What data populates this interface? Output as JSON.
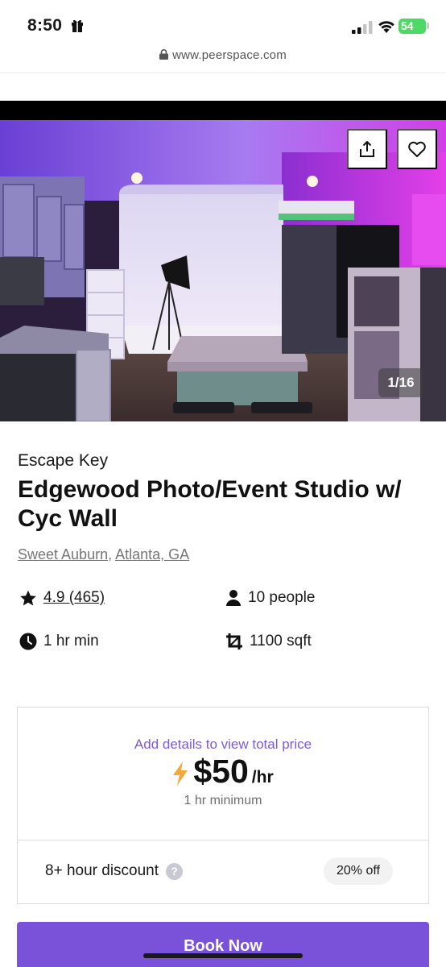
{
  "status_bar": {
    "time": "8:50",
    "battery": "54",
    "icons": [
      "gift-icon",
      "signal-icon",
      "wifi-icon",
      "battery-icon"
    ]
  },
  "browser": {
    "url": "www.peerspace.com"
  },
  "hero": {
    "photo_counter": "1/16",
    "share_icon": "share-icon",
    "favorite_icon": "heart-icon"
  },
  "listing": {
    "host": "Escape Key",
    "title": "Edgewood Photo/Event Studio w/ Cyc Wall",
    "location": {
      "neighborhood": "Sweet Auburn",
      "separator": ", ",
      "city": "Atlanta, GA"
    },
    "stats": {
      "rating": "4.9 (465)",
      "capacity": "10 people",
      "minimum": "1 hr min",
      "size": "1100 sqft"
    }
  },
  "pricing": {
    "note": "Add details to view total price",
    "amount": "$50",
    "unit": "/hr",
    "minimum": "1 hr minimum",
    "discount_label": "8+ hour discount",
    "discount_help": "?",
    "discount_value": "20% off"
  },
  "cta": {
    "book_label": "Book Now"
  },
  "colors": {
    "accent": "#7a52d9",
    "price_note": "#7b5bd6",
    "bolt": "#f0a93b",
    "battery": "#4cd964"
  }
}
